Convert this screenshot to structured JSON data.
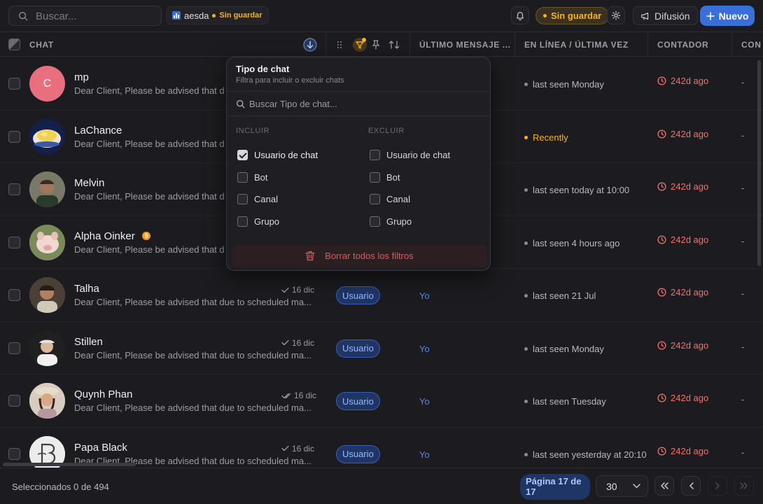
{
  "topbar": {
    "search_placeholder": "Buscar...",
    "view_name": "aesda",
    "view_status": "Sin guardar",
    "unsaved_label": "Sin guardar",
    "broadcast_label": "Difusión",
    "new_label": "Nuevo"
  },
  "columns": {
    "chat": "CHAT",
    "last_message": "ÚLTIMO MENSAJE ...",
    "online": "EN LÍNEA / ÚLTIMA VEZ",
    "counter": "CONTADOR",
    "extra": "CON"
  },
  "rows": [
    {
      "name": "mp",
      "initial": "C",
      "preview": "Dear Client, Please be advised that d",
      "date": "",
      "type": "",
      "last_by": "",
      "online": "last seen Monday",
      "recent": false,
      "counter": "242d ago",
      "extra": "-"
    },
    {
      "name": "LaChance",
      "initial": "",
      "preview": "Dear Client, Please be advised that d",
      "date": "",
      "type": "",
      "last_by": "",
      "online": "Recently",
      "recent": true,
      "counter": "242d ago",
      "extra": "-"
    },
    {
      "name": "Melvin",
      "initial": "",
      "preview": "Dear Client, Please be advised that d",
      "date": "",
      "type": "",
      "last_by": "",
      "online": "last seen today at 10:00",
      "recent": false,
      "counter": "242d ago",
      "extra": "-"
    },
    {
      "name": "Alpha Oinker",
      "initial": "",
      "preview": "Dear Client, Please be advised that d",
      "date": "",
      "type": "",
      "last_by": "",
      "online": "last seen 4 hours ago",
      "recent": false,
      "counter": "242d ago",
      "extra": "-"
    },
    {
      "name": "Talha",
      "initial": "",
      "preview": "Dear Client, Please be advised that due to scheduled ma...",
      "date": "16 dic",
      "type": "Usuario",
      "last_by": "Yo",
      "online": "last seen 21 Jul",
      "recent": false,
      "counter": "242d ago",
      "extra": "-"
    },
    {
      "name": "Stillen",
      "initial": "",
      "preview": "Dear Client, Please be advised that due to scheduled ma...",
      "date": "16 dic",
      "type": "Usuario",
      "last_by": "Yo",
      "online": "last seen Monday",
      "recent": false,
      "counter": "242d ago",
      "extra": "-"
    },
    {
      "name": "Quynh Phan",
      "initial": "",
      "preview": "Dear Client, Please be advised that due to scheduled ma...",
      "date": "16 dic",
      "type": "Usuario",
      "last_by": "Yo",
      "online": "last seen Tuesday",
      "recent": false,
      "counter": "242d ago",
      "extra": "-"
    },
    {
      "name": "Papa Black",
      "initial": "",
      "preview": "Dear Client, Please be advised that due to scheduled ma...",
      "date": "16 dic",
      "type": "Usuario",
      "last_by": "Yo",
      "online": "last seen yesterday at 20:10",
      "recent": false,
      "counter": "242d ago",
      "extra": "-"
    }
  ],
  "filter": {
    "title": "Tipo de chat",
    "subtitle": "Filtra para incluir o excluir chats",
    "search_placeholder": "Buscar Tipo de chat...",
    "include_label": "INCLUIR",
    "exclude_label": "EXCLUIR",
    "include_options": [
      {
        "label": "Usuario de chat",
        "checked": true
      },
      {
        "label": "Bot",
        "checked": false
      },
      {
        "label": "Canal",
        "checked": false
      },
      {
        "label": "Grupo",
        "checked": false
      }
    ],
    "exclude_options": [
      {
        "label": "Usuario de chat",
        "checked": false
      },
      {
        "label": "Bot",
        "checked": false
      },
      {
        "label": "Canal",
        "checked": false
      },
      {
        "label": "Grupo",
        "checked": false
      }
    ],
    "clear_label": "Borrar todos los filtros"
  },
  "footer": {
    "selected": "Seleccionados 0 de 494",
    "page_label": "Página 17 de 17",
    "per_page": "30"
  },
  "colors": {
    "accent": "#3a6fd8",
    "warning": "#f5b325",
    "danger": "#f07272"
  }
}
